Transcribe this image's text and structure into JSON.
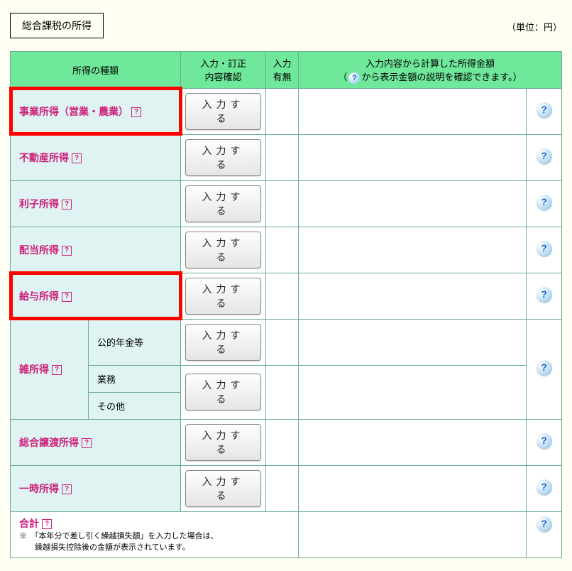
{
  "section_title": "総合課税の所得",
  "unit_label": "（単位：円）",
  "header": {
    "col_type": "所得の種類",
    "col_input": "入力・訂正\n内容確認",
    "col_has": "入力\n有無",
    "col_calc": "入力内容から計算した所得金額",
    "col_calc_sub_a": "（",
    "col_calc_sub_b": "から表示金額の説明を確認できます。）"
  },
  "btn_label": "入力する",
  "rows": {
    "r1": "事業所得（営業・農業）",
    "r2": "不動産所得",
    "r3": "利子所得",
    "r4": "配当所得",
    "r5": "給与所得",
    "r6": "雑所得",
    "r6a": "公的年金等",
    "r6b": "業務",
    "r6c": "その他",
    "r7": "総合譲渡所得",
    "r8": "一時所得"
  },
  "total": {
    "label": "合計",
    "note": "※　「本年分で差し引く繰越損失額」を入力した場合は、\n　　繰越損失控除後の金額が表示されています。"
  }
}
